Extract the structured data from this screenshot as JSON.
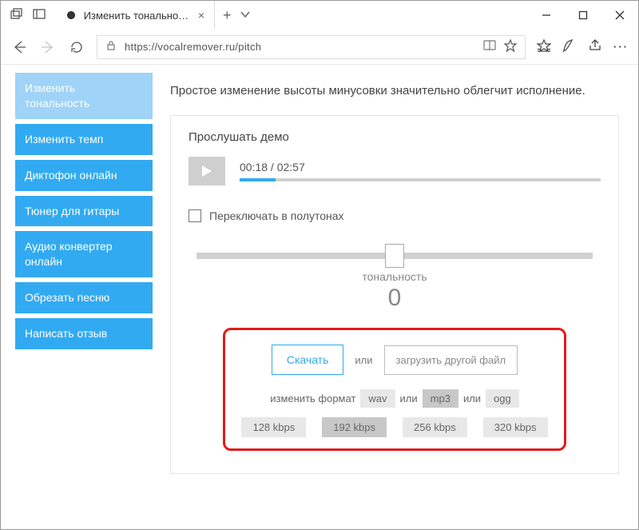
{
  "window": {
    "tab_title": "Изменить тональность",
    "url": "https://vocalremover.ru/pitch"
  },
  "sidebar": {
    "items": [
      {
        "label": "Изменить тональность",
        "active": true
      },
      {
        "label": "Изменить темп",
        "active": false
      },
      {
        "label": "Диктофон онлайн",
        "active": false
      },
      {
        "label": "Тюнер для гитары",
        "active": false
      },
      {
        "label": "Аудио конвертер онлайн",
        "active": false
      },
      {
        "label": "Обрезать песню",
        "active": false
      },
      {
        "label": "Написать отзыв",
        "active": false
      }
    ]
  },
  "main": {
    "lead_text": "Простое изменение высоты минусовки значительно облегчит исполнение.",
    "demo_title": "Прослушать демо",
    "time_display": "00:18 / 02:57",
    "semitone_checkbox": "Переключать в полутонах",
    "slider_label": "тональность",
    "slider_value": "0",
    "download": {
      "download_btn": "Скачать",
      "or_text": "или",
      "upload_btn": "загрузить другой файл",
      "format_label": "изменить формат",
      "formats": {
        "wav": "wav",
        "mp3": "mp3",
        "ogg": "ogg"
      },
      "bitrates": {
        "b128": "128 kbps",
        "b192": "192 kbps",
        "b256": "256 kbps",
        "b320": "320 kbps"
      }
    }
  }
}
